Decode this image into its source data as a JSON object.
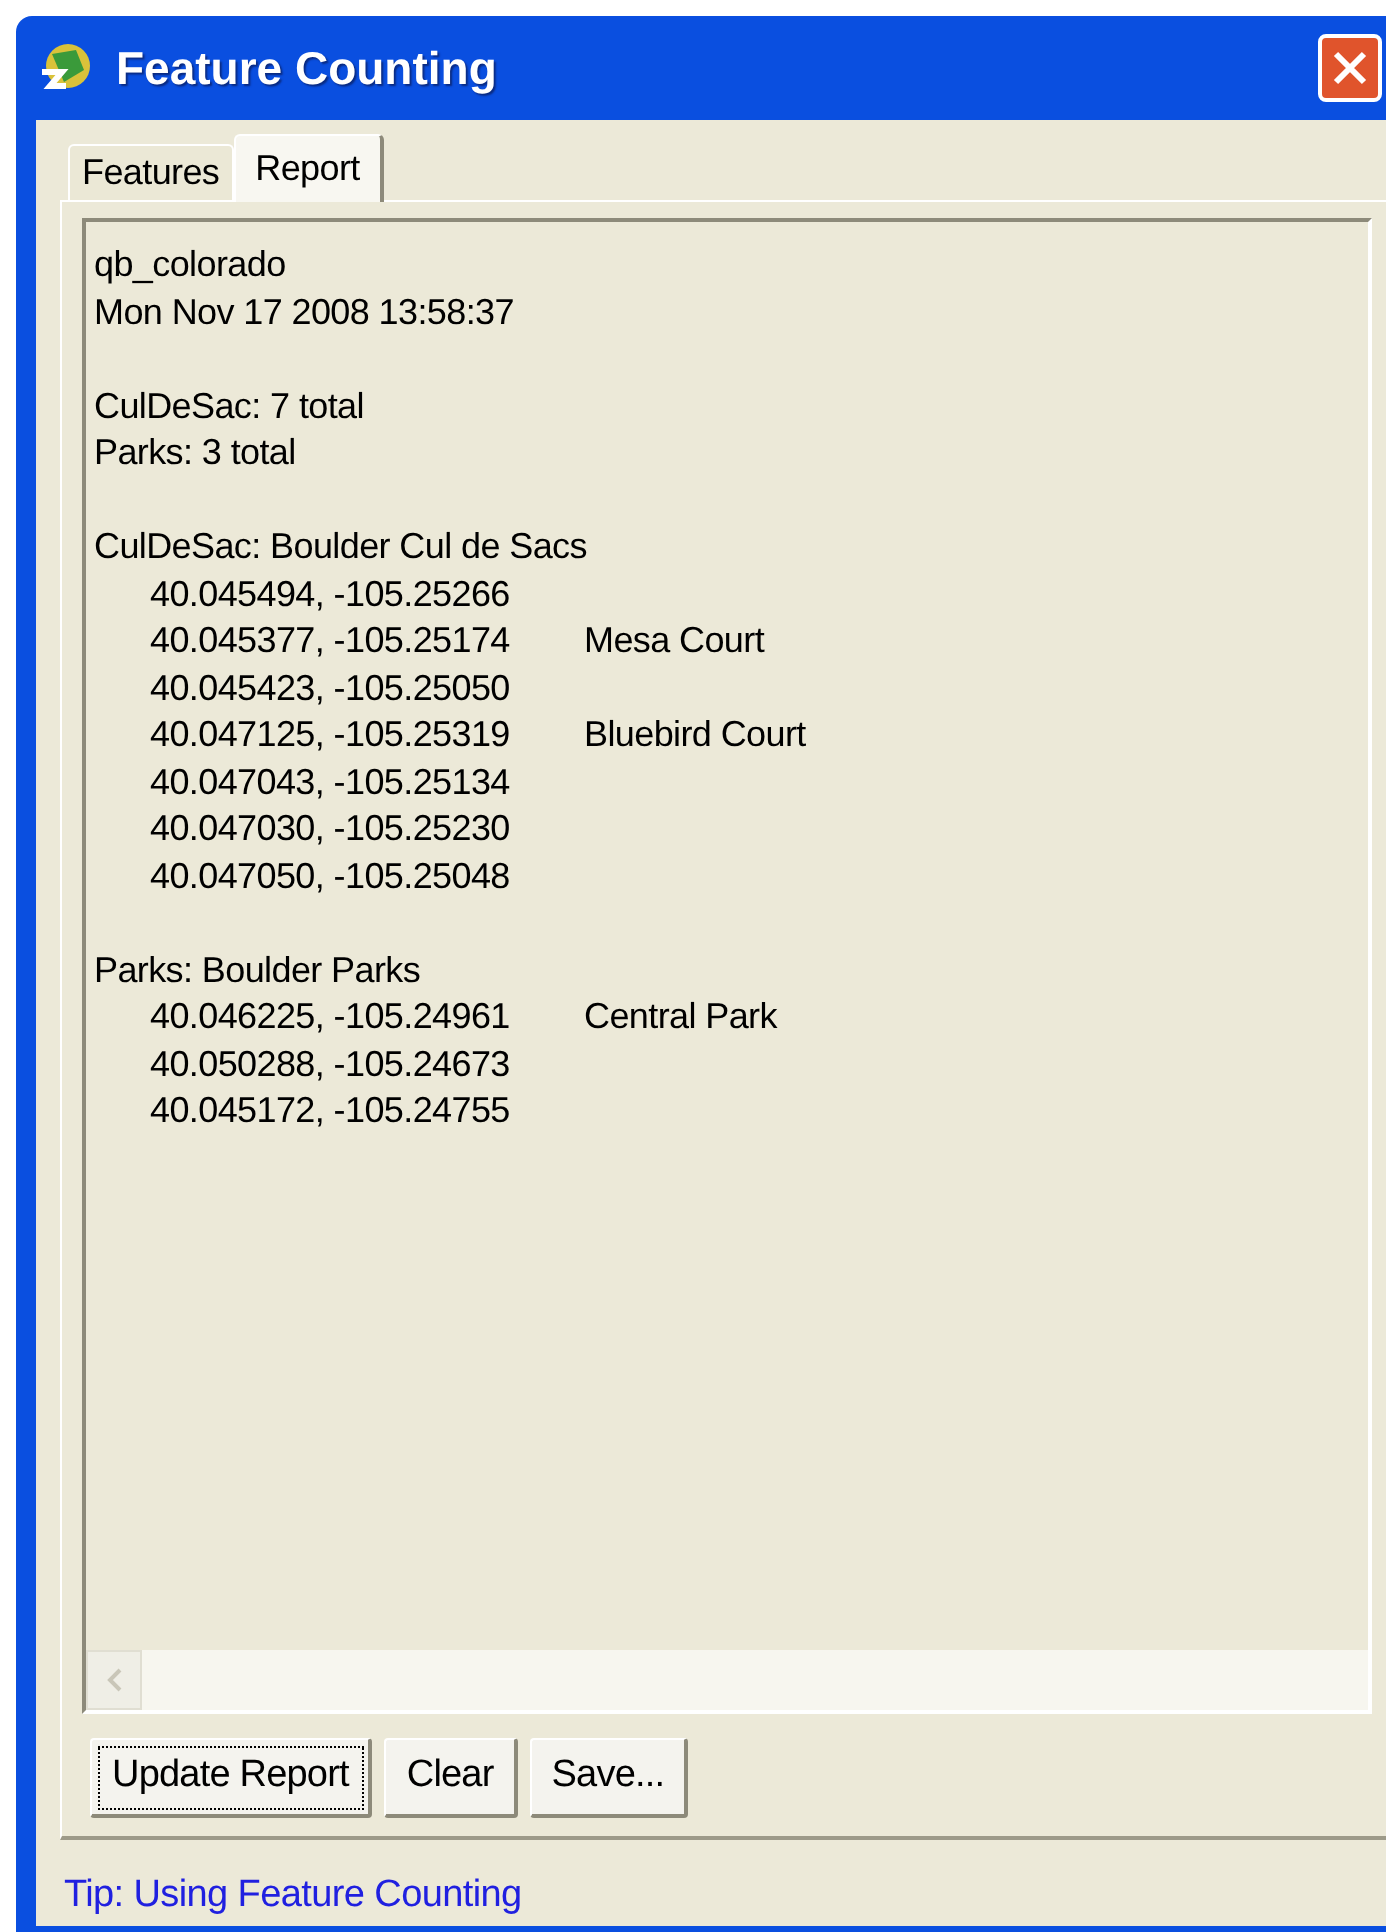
{
  "window": {
    "title": "Feature Counting"
  },
  "tabs": [
    {
      "label": "Features",
      "selected": false
    },
    {
      "label": "Report",
      "selected": true
    }
  ],
  "report": {
    "blocks": [
      {
        "lines": [
          {
            "kind": "text",
            "text": "qb_colorado"
          },
          {
            "kind": "text",
            "text": "Mon Nov 17 2008 13:58:37"
          }
        ]
      },
      {
        "lines": [
          {
            "kind": "text",
            "text": "CulDeSac: 7 total"
          },
          {
            "kind": "text",
            "text": "Parks: 3 total"
          }
        ]
      },
      {
        "lines": [
          {
            "kind": "text",
            "text": "CulDeSac: Boulder Cul de Sacs"
          },
          {
            "kind": "point",
            "coords": "40.045494, -105.25266"
          },
          {
            "kind": "point",
            "coords": "40.045377, -105.25174",
            "place": "Mesa Court"
          },
          {
            "kind": "point",
            "coords": "40.045423, -105.25050"
          },
          {
            "kind": "point",
            "coords": "40.047125, -105.25319",
            "place": "Bluebird Court"
          },
          {
            "kind": "point",
            "coords": "40.047043, -105.25134"
          },
          {
            "kind": "point",
            "coords": "40.047030, -105.25230"
          },
          {
            "kind": "point",
            "coords": "40.047050, -105.25048"
          }
        ]
      },
      {
        "lines": [
          {
            "kind": "text",
            "text": "Parks: Boulder Parks"
          },
          {
            "kind": "point",
            "coords": "40.046225, -105.24961",
            "place": "Central Park"
          },
          {
            "kind": "point",
            "coords": "40.050288, -105.24673"
          },
          {
            "kind": "point",
            "coords": "40.045172, -105.24755"
          }
        ]
      }
    ]
  },
  "buttons": [
    {
      "label": "Update Report",
      "focused": true
    },
    {
      "label": "Clear",
      "focused": false
    },
    {
      "label": "Save...",
      "focused": false
    }
  ],
  "tip": "Tip: Using Feature Counting"
}
